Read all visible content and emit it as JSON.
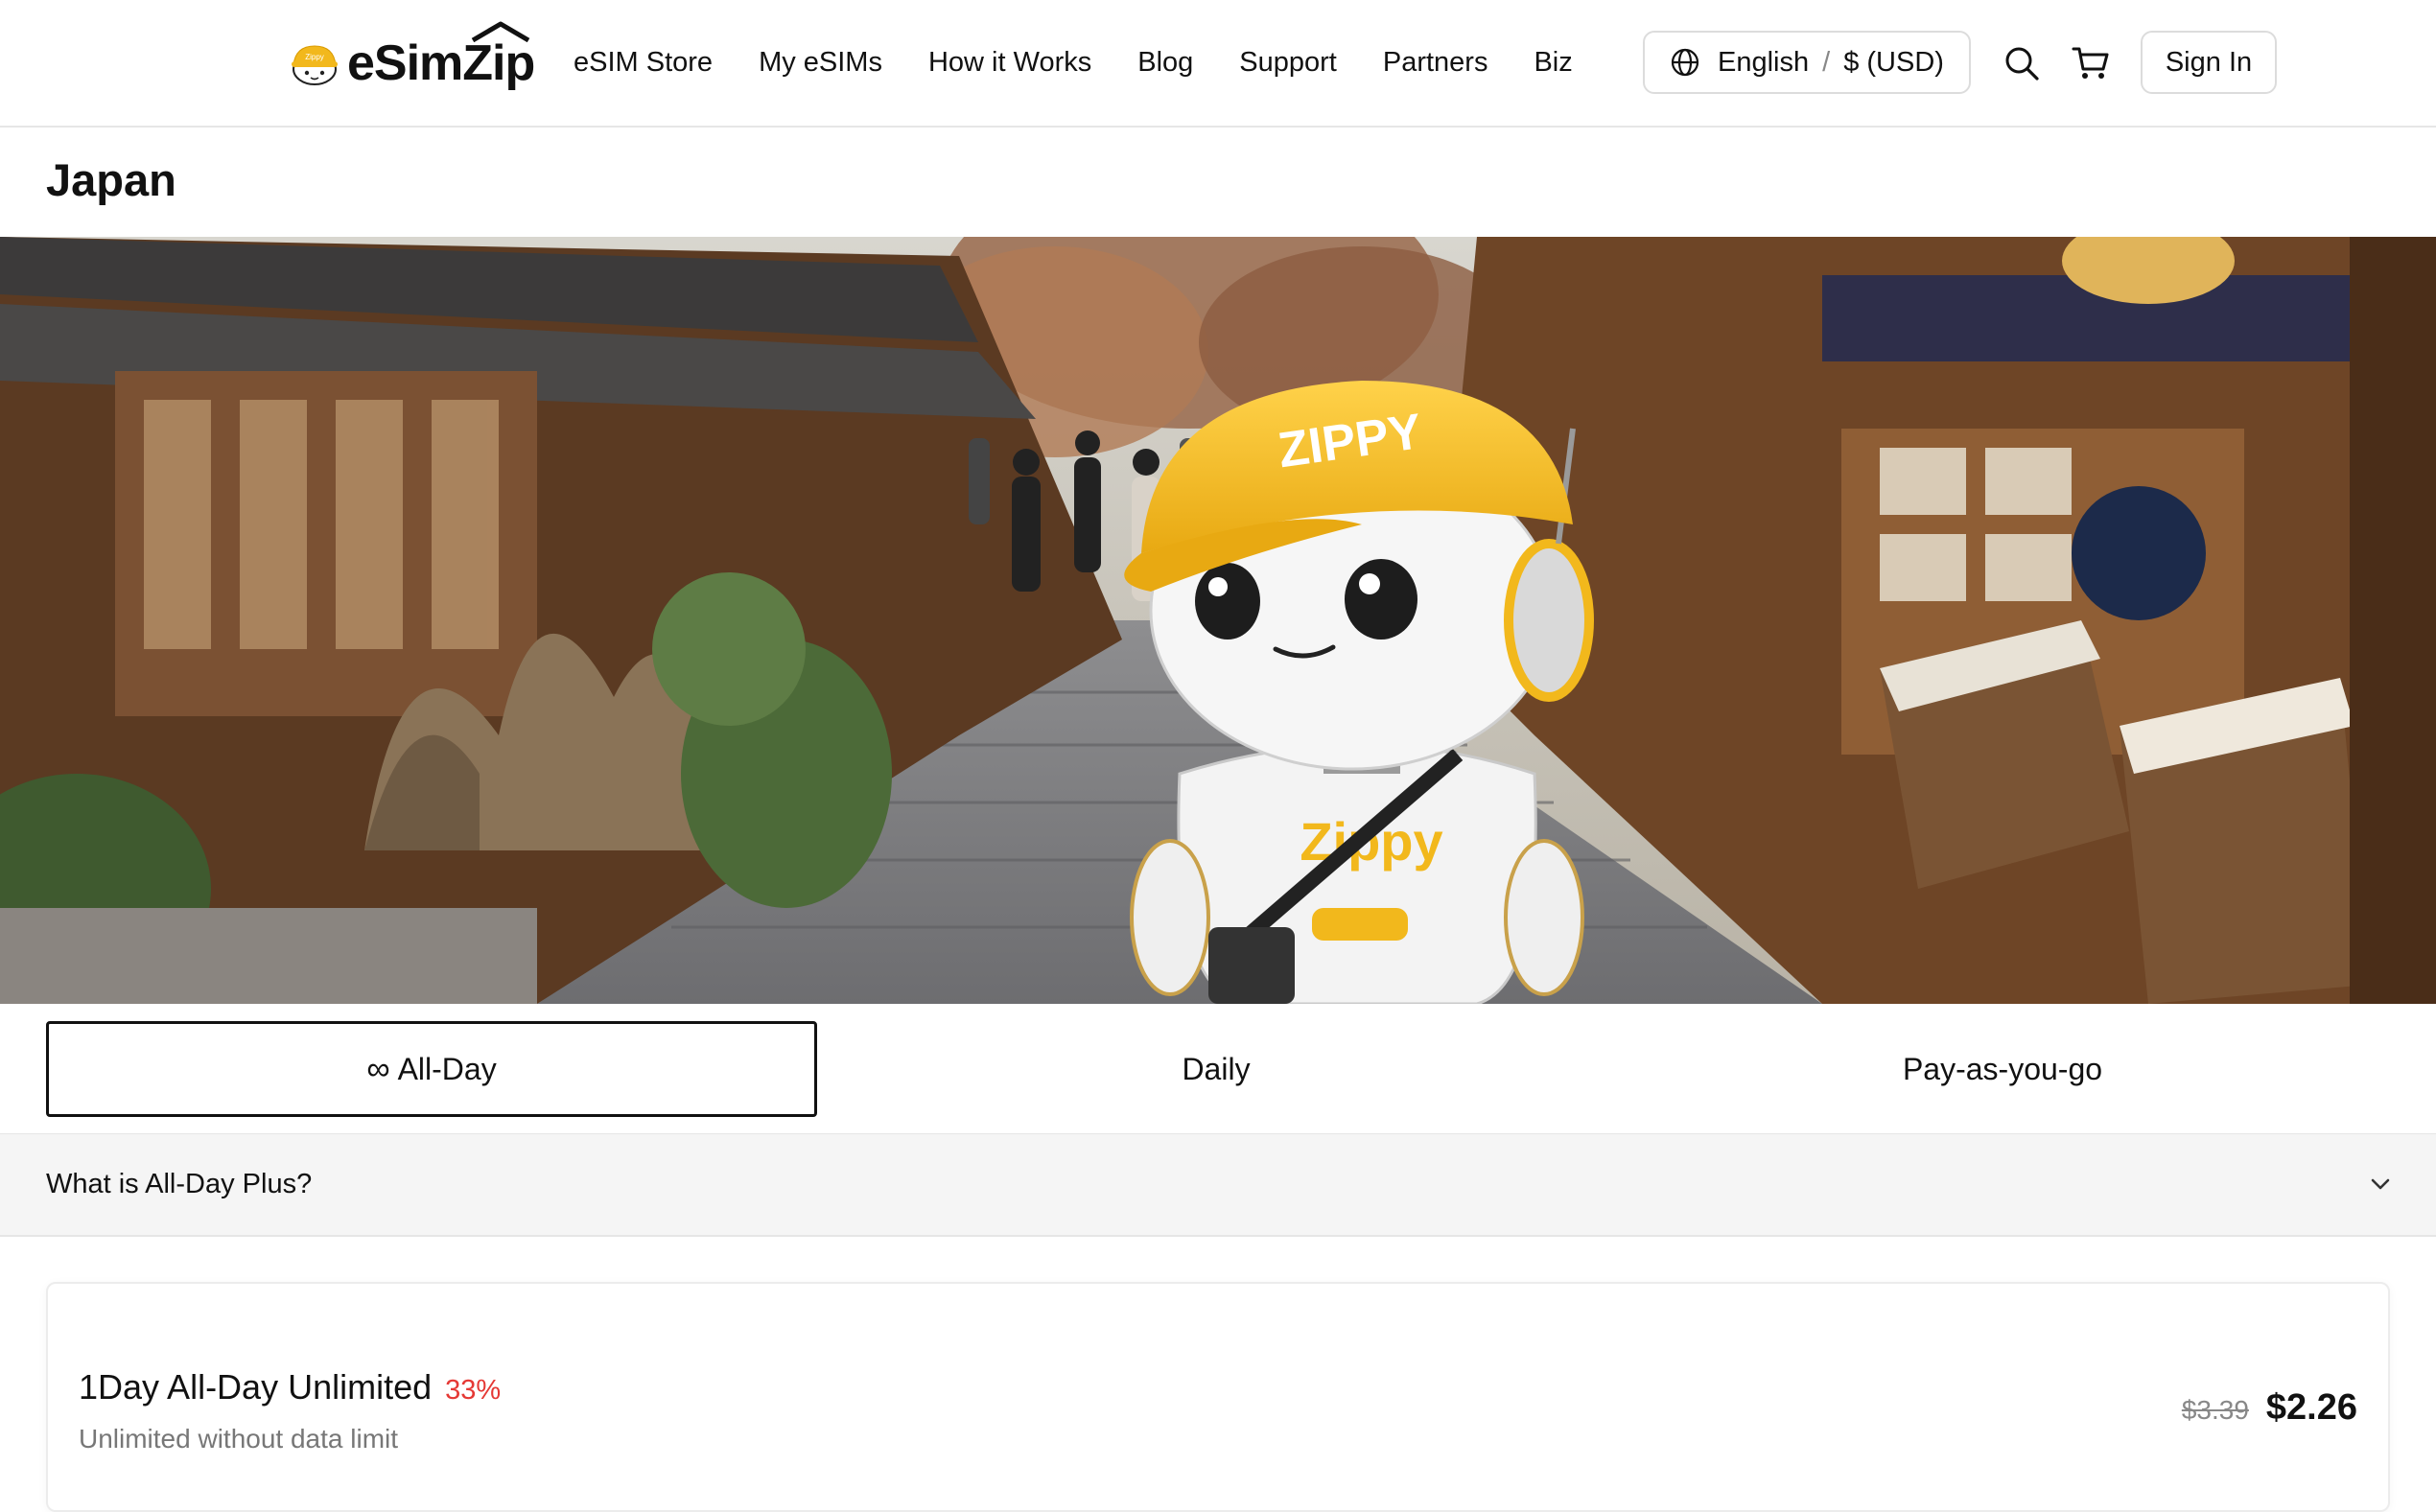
{
  "header": {
    "logo_text": "eSimZip",
    "logo_badge": "Zippy",
    "nav": [
      "eSIM Store",
      "My eSIMs",
      "How it Works",
      "Blog",
      "Support",
      "Partners",
      "Biz"
    ],
    "language": "English",
    "separator": "/",
    "currency": "$ (USD)",
    "sign_in": "Sign In",
    "icons": [
      "globe-icon",
      "search-icon",
      "cart-icon"
    ]
  },
  "page": {
    "title": "Japan"
  },
  "hero": {
    "scene": "Kyoto stone-paved street with wooden buildings and a robot mascot in a yellow cap",
    "cap_text": "ZIPPY",
    "body_text": "Zippy"
  },
  "tabs": [
    {
      "label": "All-Day",
      "icon": "∞",
      "active": true
    },
    {
      "label": "Daily",
      "active": false
    },
    {
      "label": "Pay-as-you-go",
      "active": false
    }
  ],
  "faq": {
    "question": "What is All-Day Plus?"
  },
  "plans": [
    {
      "name": "1Day All-Day Unlimited",
      "discount": "33%",
      "subtitle": "Unlimited without data limit",
      "original_price": "$3.39",
      "price": "$2.26"
    }
  ],
  "colors": {
    "accent_yellow": "#f2b81c",
    "discount_red": "#e53935",
    "text": "#111111",
    "muted": "#777777"
  }
}
